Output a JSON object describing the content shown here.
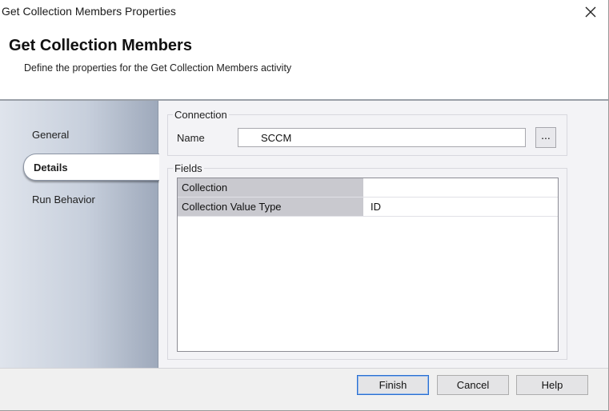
{
  "window": {
    "title": "Get Collection Members Properties"
  },
  "header": {
    "heading": "Get Collection Members",
    "subheading": "Define the properties for the Get Collection Members activity"
  },
  "nav": {
    "items": [
      {
        "label": "General",
        "selected": false
      },
      {
        "label": "Details",
        "selected": true
      },
      {
        "label": "Run Behavior",
        "selected": false
      }
    ]
  },
  "connection": {
    "group_title": "Connection",
    "name_label": "Name",
    "name_value": "SCCM",
    "browse_label": "..."
  },
  "fields": {
    "group_title": "Fields",
    "rows": [
      {
        "key": "Collection",
        "value": ""
      },
      {
        "key": "Collection Value Type",
        "value": "ID"
      }
    ]
  },
  "buttons": {
    "finish": "Finish",
    "cancel": "Cancel",
    "help": "Help"
  }
}
